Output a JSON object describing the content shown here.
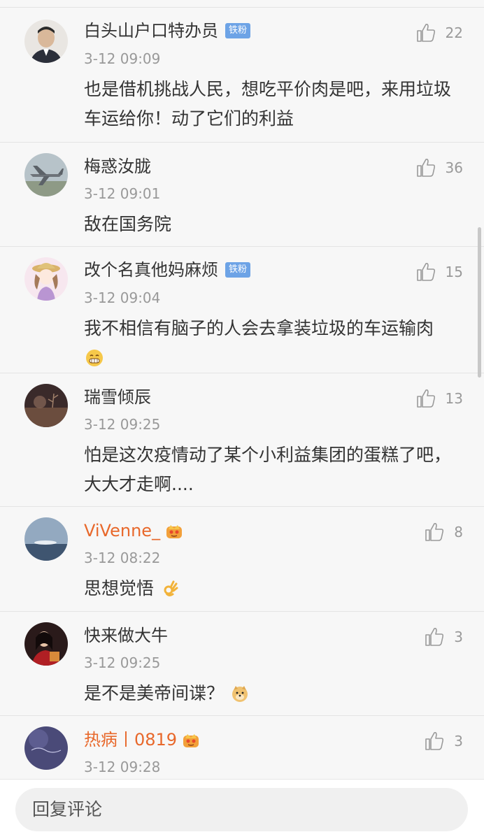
{
  "comments": [
    {
      "user": "白头山户口特办员",
      "badge": "铁粉",
      "time": "3-12 09:09",
      "text": "也是借机挑战人民，想吃平价肉是吧，来用垃圾车运给你！动了它们的利益",
      "likes": "22"
    },
    {
      "user": "梅惑汝胧",
      "time": "3-12 09:01",
      "text": "敌在国务院",
      "likes": "36"
    },
    {
      "user": "改个名真他妈麻烦",
      "badge": "铁粉",
      "time": "3-12 09:04",
      "text": "我不相信有脑子的人会去拿装垃圾的车运输肉",
      "emoji": "grin-emoji",
      "likes": "15"
    },
    {
      "user": "瑞雪倾辰",
      "time": "3-12 09:25",
      "text": "怕是这次疫情动了某个小利益集团的蛋糕了吧，大大才走啊....",
      "likes": "13"
    },
    {
      "user": "ViVenne_",
      "vip": true,
      "time": "3-12 08:22",
      "text": "思想觉悟",
      "emoji": "ok-hand-emoji",
      "likes": "8"
    },
    {
      "user": "快来做大牛",
      "time": "3-12 09:25",
      "text": "是不是美帝间谍？",
      "emoji": "doge-emoji",
      "likes": "3"
    },
    {
      "user": "热病丨0819",
      "vip": true,
      "time": "3-12 09:28",
      "likes": "3"
    }
  ],
  "reply": {
    "placeholder": "回复评论"
  },
  "colors": {
    "vip_name": "#e8682b",
    "badge_bg": "#6da3e6",
    "meta_text": "#999999"
  }
}
